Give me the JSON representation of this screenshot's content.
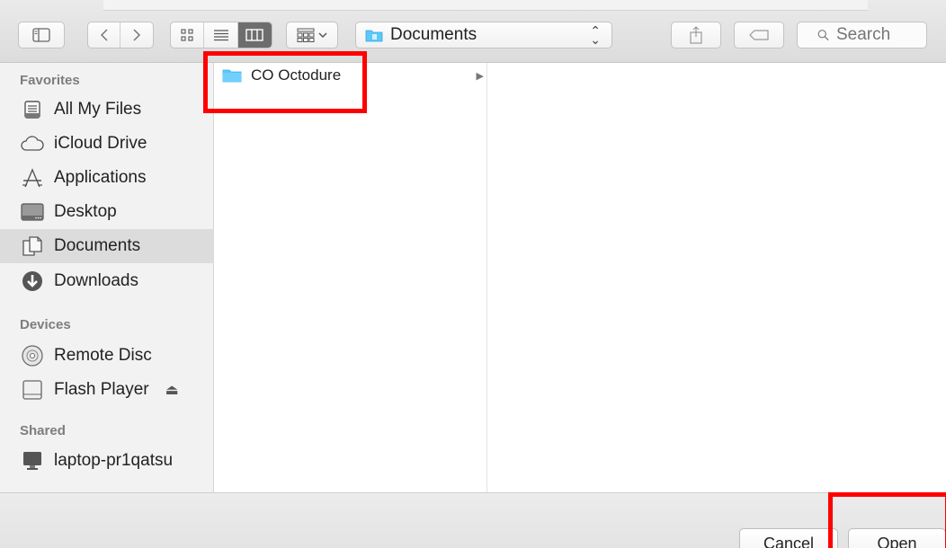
{
  "toolbar": {
    "location": "Documents",
    "search_placeholder": "Search"
  },
  "sidebar": {
    "sections": [
      {
        "title": "Favorites"
      },
      {
        "title": "Devices"
      },
      {
        "title": "Shared"
      }
    ],
    "favorites": [
      {
        "label": "All My Files",
        "icon": "all-my-files-icon"
      },
      {
        "label": "iCloud Drive",
        "icon": "cloud-icon"
      },
      {
        "label": "Applications",
        "icon": "applications-icon"
      },
      {
        "label": "Desktop",
        "icon": "desktop-icon"
      },
      {
        "label": "Documents",
        "icon": "documents-icon",
        "selected": true
      },
      {
        "label": "Downloads",
        "icon": "download-icon"
      }
    ],
    "devices": [
      {
        "label": "Remote Disc",
        "icon": "disc-icon"
      },
      {
        "label": "Flash Player",
        "icon": "drive-icon",
        "eject": "⏏"
      }
    ],
    "shared": [
      {
        "label": "laptop-pr1qatsu",
        "icon": "computer-icon"
      }
    ]
  },
  "browser": {
    "column1": [
      {
        "label": "CO Octodure",
        "icon": "folder-icon"
      }
    ]
  },
  "buttons": {
    "cancel": "Cancel",
    "open": "Open"
  },
  "colors": {
    "annotation": "#ff0000",
    "folder": "#5ac8fa",
    "selection": "#dcdcdc"
  }
}
